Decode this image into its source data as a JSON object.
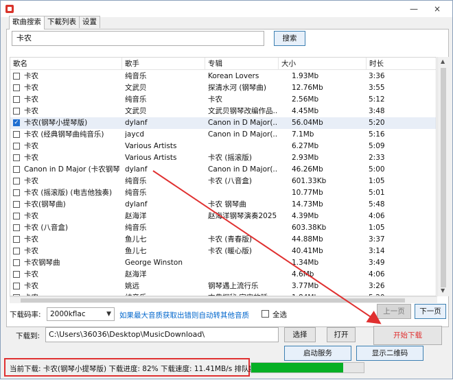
{
  "window": {
    "minimize": "—",
    "close": "×"
  },
  "tabs": [
    "歌曲搜索",
    "下載列表",
    "设置"
  ],
  "search": {
    "value": "卡农",
    "button": "搜索"
  },
  "table": {
    "headers": [
      "歌名",
      "歌手",
      "专辑",
      "大小",
      "时长"
    ],
    "rows": [
      {
        "checked": false,
        "title": "卡农",
        "artist": "纯音乐",
        "album": "Korean Lovers",
        "size": "1.93Mb",
        "duration": "3:36"
      },
      {
        "checked": false,
        "title": "卡农",
        "artist": "文武贝",
        "album": "探清水河 (钢琴曲)",
        "size": "12.76Mb",
        "duration": "3:55"
      },
      {
        "checked": false,
        "title": "卡农",
        "artist": "纯音乐",
        "album": "卡农",
        "size": "2.56Mb",
        "duration": "5:12"
      },
      {
        "checked": false,
        "title": "卡农",
        "artist": "文武贝",
        "album": "文武贝钢琴改编作品...",
        "size": "4.45Mb",
        "duration": "3:48"
      },
      {
        "checked": true,
        "title": "卡农(钢琴小提琴版)",
        "artist": "dylanf",
        "album": "Canon in D Major(...",
        "size": "56.04Mb",
        "duration": "5:20"
      },
      {
        "checked": false,
        "title": "卡农 (经典钢琴曲纯音乐)",
        "artist": "jaycd",
        "album": "Canon in D Major(...",
        "size": "7.1Mb",
        "duration": "5:16"
      },
      {
        "checked": false,
        "title": "卡农",
        "artist": "Various Artists",
        "album": "",
        "size": "6.27Mb",
        "duration": "5:09"
      },
      {
        "checked": false,
        "title": "卡农",
        "artist": "Various Artists",
        "album": "卡农 (摇滚版)",
        "size": "2.93Mb",
        "duration": "2:33"
      },
      {
        "checked": false,
        "title": "Canon in D Major (卡农钢琴...",
        "artist": "dylanf",
        "album": "Canon in D Major(...",
        "size": "46.26Mb",
        "duration": "5:00"
      },
      {
        "checked": false,
        "title": "卡农",
        "artist": "纯音乐",
        "album": "卡农 (八音盒)",
        "size": "601.33Kb",
        "duration": "1:05"
      },
      {
        "checked": false,
        "title": "卡农 (摇滚版) (电吉他独奏)",
        "artist": "纯音乐",
        "album": "",
        "size": "10.77Mb",
        "duration": "5:01"
      },
      {
        "checked": false,
        "title": "卡农(钢琴曲)",
        "artist": "dylanf",
        "album": "卡农 钢琴曲",
        "size": "14.73Mb",
        "duration": "5:48"
      },
      {
        "checked": false,
        "title": "卡农",
        "artist": "赵海洋",
        "album": "赵海洋钢琴演奏2025",
        "size": "4.39Mb",
        "duration": "4:06"
      },
      {
        "checked": false,
        "title": "卡农 (八音盒)",
        "artist": "纯音乐",
        "album": "",
        "size": "603.38Kb",
        "duration": "1:05"
      },
      {
        "checked": false,
        "title": "卡农",
        "artist": "鱼儿七",
        "album": "卡农 (青春版)",
        "size": "44.88Mb",
        "duration": "3:37"
      },
      {
        "checked": false,
        "title": "卡农",
        "artist": "鱼儿七",
        "album": "卡农 (暖心版)",
        "size": "40.41Mb",
        "duration": "3:14"
      },
      {
        "checked": false,
        "title": "卡农钢琴曲",
        "artist": "George Winston",
        "album": "",
        "size": "1.34Mb",
        "duration": "3:49"
      },
      {
        "checked": false,
        "title": "卡农",
        "artist": "赵海洋",
        "album": "",
        "size": "4.6Mb",
        "duration": "4:06"
      },
      {
        "checked": false,
        "title": "卡农",
        "artist": "姚远",
        "album": "钢琴遇上流行乐",
        "size": "3.77Mb",
        "duration": "3:26"
      },
      {
        "checked": false,
        "title": "卡农",
        "artist": "纯音乐",
        "album": "古典探秘 宇宙的睡...",
        "size": "1.84Mb",
        "duration": "5:20"
      }
    ]
  },
  "pager": {
    "prev": "上一页",
    "next": "下一页"
  },
  "bitrate": {
    "label": "下载码率:",
    "value": "2000kflac"
  },
  "hint": "如果最大音质获取出错则自动转其他音质",
  "select_all": "全选",
  "download_to": {
    "label": "下载到:",
    "path": "C:\\Users\\36036\\Desktop\\MusicDownload\\"
  },
  "buttons": {
    "choose": "选择",
    "open": "打开",
    "start": "开始下载",
    "service": "启动服务",
    "qrcode": "显示二维码"
  },
  "status": {
    "text": "当前下载: 卡农(钢琴小提琴版) 下载进度: 82% 下载速度: 11.41MB/s 排队数:0",
    "progress": 0.82
  },
  "colors": {
    "accent": "#e03030",
    "progress": "#06b025"
  }
}
